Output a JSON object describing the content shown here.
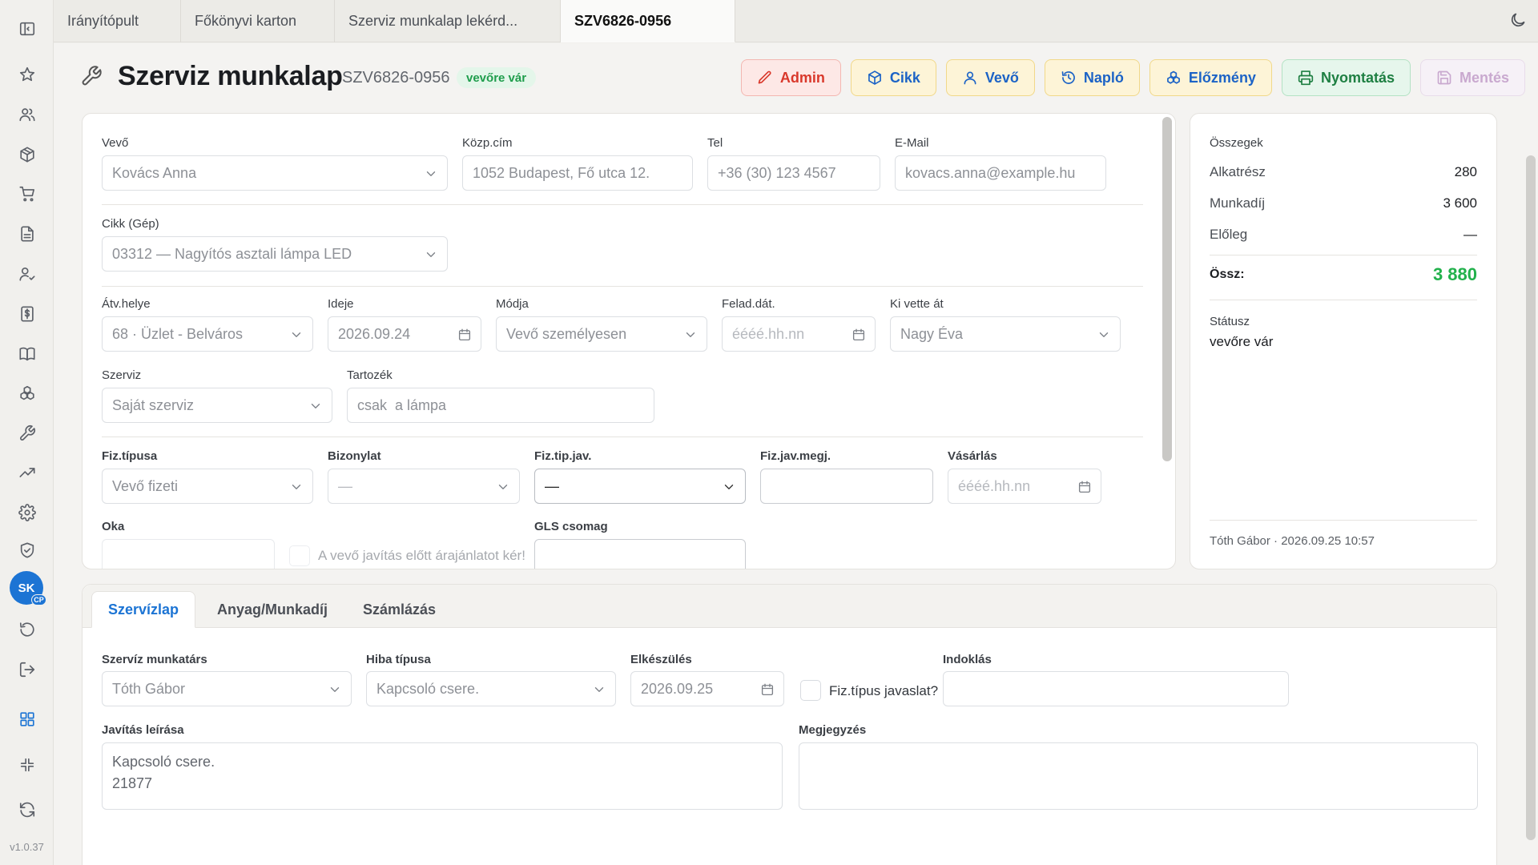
{
  "app": {
    "version": "v1.0.37"
  },
  "user": {
    "initials": "SK",
    "badge": "CP"
  },
  "tabs": [
    {
      "label": "Irányítópult"
    },
    {
      "label": "Főkönyvi karton"
    },
    {
      "label": "Szerviz munkalap lekérd..."
    },
    {
      "label": "SZV6826-0956"
    }
  ],
  "header": {
    "title": "Szerviz munkalap",
    "doc_id": "SZV6826-0956",
    "status": "vevőre vár",
    "buttons": {
      "admin": "Admin",
      "cikk": "Cikk",
      "vevo": "Vevő",
      "naplo": "Napló",
      "elozmeny": "Előzmény",
      "print": "Nyomtatás",
      "save": "Mentés"
    }
  },
  "form": {
    "vevo": {
      "label": "Vevő",
      "value": "Kovács Anna"
    },
    "kozpcim": {
      "label": "Közp.cím",
      "value": "1052 Budapest, Fő utca 12."
    },
    "tel": {
      "label": "Tel",
      "value": "+36 (30) 123 4567"
    },
    "email": {
      "label": "E-Mail",
      "value": "kovacs.anna@example.hu"
    },
    "cikk": {
      "label": "Cikk (Gép)",
      "value": "03312 — Nagyítós asztali lámpa LED"
    },
    "atvhelye": {
      "label": "Átv.helye",
      "value": "68 · Üzlet - Belváros"
    },
    "ideje": {
      "label": "Ideje",
      "value": "2026.09.24"
    },
    "modja": {
      "label": "Módja",
      "value": "Vevő személyesen"
    },
    "feladdat": {
      "label": "Felad.dát.",
      "placeholder": "éééé.hh.nn"
    },
    "kivetteat": {
      "label": "Ki vette át",
      "value": "Nagy Éva"
    },
    "szerviz": {
      "label": "Szerviz",
      "value": "Saját szerviz"
    },
    "tartozek": {
      "label": "Tartozék",
      "value": "csak  a lámpa"
    },
    "fiztipusa": {
      "label": "Fiz.típusa",
      "value": "Vevő fizeti"
    },
    "bizonylat": {
      "label": "Bizonylat",
      "value": "—"
    },
    "fiztipjav": {
      "label": "Fiz.tip.jav.",
      "value": "—"
    },
    "fizjavmegj": {
      "label": "Fiz.jav.megj.",
      "value": ""
    },
    "vasarlas": {
      "label": "Vásárlás",
      "placeholder": "éééé.hh.nn"
    },
    "oka": {
      "label": "Oka",
      "value": ""
    },
    "arajanlat": {
      "label": "A vevő javítás előtt árajánlatot kér!"
    },
    "gls": {
      "label": "GLS csomag",
      "value": ""
    }
  },
  "summary": {
    "title": "Összegek",
    "rows": [
      {
        "label": "Alkatrész",
        "value": "280"
      },
      {
        "label": "Munkadíj",
        "value": "3 600"
      },
      {
        "label": "Előleg",
        "value": "—"
      }
    ],
    "total_label": "Össz:",
    "total_value": "3 880",
    "status_label": "Státusz",
    "status_value": "vevőre vár",
    "footer": "Tóth Gábor · 2026.09.25 10:57"
  },
  "lower_tabs": [
    {
      "label": "Szervízlap"
    },
    {
      "label": "Anyag/Munkadíj"
    },
    {
      "label": "Számlázás"
    }
  ],
  "service": {
    "munkatars": {
      "label": "Szervíz munkatárs",
      "value": "Tóth Gábor"
    },
    "hibatipus": {
      "label": "Hiba típusa",
      "value": "Kapcsoló csere."
    },
    "elkeszules": {
      "label": "Elkészülés",
      "value": "2026.09.25"
    },
    "fiztipus_javaslat": {
      "label": "Fiz.típus javaslat?"
    },
    "indoklas": {
      "label": "Indoklás",
      "value": ""
    },
    "javitas_leirasa": {
      "label": "Javítás leírása",
      "value": "Kapcsoló csere.\n21877"
    },
    "megjegyzes": {
      "label": "Megjegyzés",
      "value": ""
    }
  },
  "colors": {
    "accent": "#1c74d4",
    "status_green": "#1f9d4c",
    "total_green": "#22b14c",
    "admin_red": "#d9382b"
  }
}
